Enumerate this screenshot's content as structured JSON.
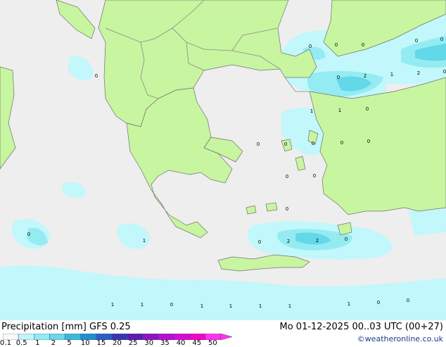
{
  "legend": {
    "title": "Precipitation [mm]  GFS 0.25",
    "datetime": "Mo 01-12-2025 00..03 UTC (00+27)",
    "credit": "©weatheronline.co.uk",
    "ticks": [
      "0.1",
      "0.5",
      "1",
      "2",
      "5",
      "10",
      "15",
      "20",
      "25",
      "30",
      "35",
      "40",
      "45",
      "50"
    ],
    "colors": [
      "#f5fbff",
      "#bff4ff",
      "#92eaf2",
      "#6cd6ea",
      "#3bb8df",
      "#1f8fd0",
      "#2a5fc4",
      "#3737b3",
      "#5a1fb0",
      "#8c14c4",
      "#b60fd4",
      "#d60ad6",
      "#ee08c8",
      "#ff33ee"
    ]
  },
  "colors": {
    "sea": "#eeeeee",
    "land": "#c8f5a0",
    "precip_light": "#c2f7fb",
    "precip_mid": "#94ecf2",
    "precip_strong": "#62d8e8",
    "border": "#8a8a8a",
    "coast": "#707070"
  },
  "map_labels": [
    "0",
    "0",
    "0",
    "0",
    "0",
    "2",
    "2",
    "1",
    "0",
    "1",
    "1",
    "0",
    "0",
    "0",
    "0",
    "0",
    "0",
    "0",
    "0",
    "0",
    "0",
    "2",
    "2",
    "0",
    "0",
    "0",
    "0",
    "1",
    "1",
    "1",
    "0",
    "1",
    "0",
    "0"
  ]
}
